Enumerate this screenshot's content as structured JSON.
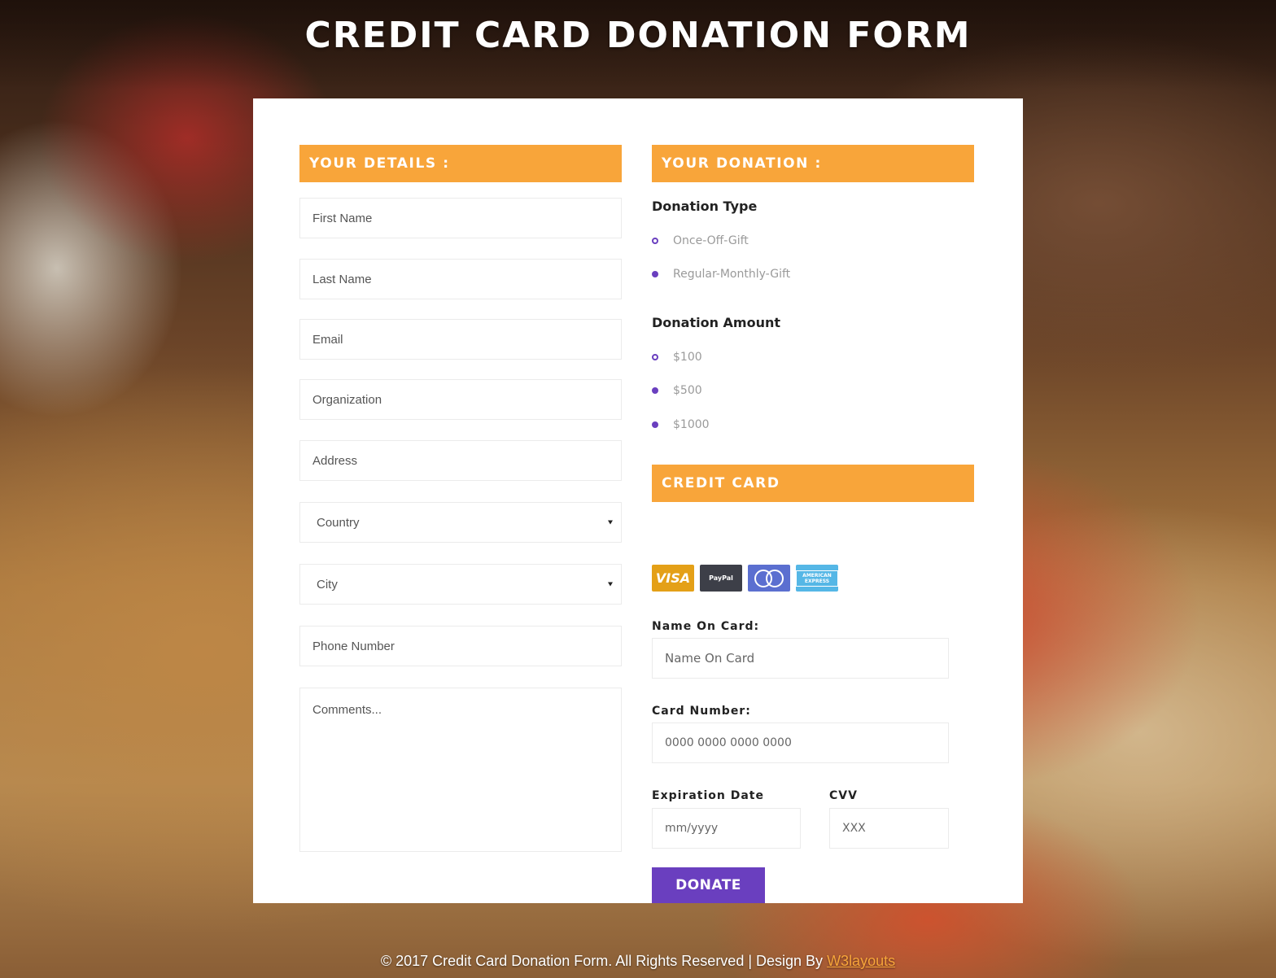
{
  "title": "CREDIT CARD DONATION FORM",
  "details": {
    "heading": "YOUR DETAILS :",
    "first_name": "First Name",
    "last_name": "Last Name",
    "email": "Email",
    "organization": "Organization",
    "address": "Address",
    "country": "Country",
    "city": "City",
    "phone": "Phone Number",
    "comments": "Comments..."
  },
  "donation": {
    "heading": "YOUR DONATION :",
    "type_label": "Donation Type",
    "types": [
      {
        "label": "Once-Off-Gift",
        "selected": false
      },
      {
        "label": "Regular-Monthly-Gift",
        "selected": true
      }
    ],
    "amount_label": "Donation Amount",
    "amounts": [
      {
        "label": "$100",
        "selected": false
      },
      {
        "label": "$500",
        "selected": true
      },
      {
        "label": "$1000",
        "selected": true
      }
    ]
  },
  "credit_card": {
    "heading": "CREDIT CARD",
    "logos": {
      "visa": "VISA",
      "paypal": "PayPal",
      "amex": "AMERICAN EXPRESS"
    },
    "name_label": "Name On Card:",
    "name_placeholder": "Name On Card",
    "number_label": "Card Number:",
    "number_placeholder": "0000 0000 0000 0000",
    "exp_label": "Expiration Date",
    "exp_placeholder": "mm/yyyy",
    "cvv_label": "CVV",
    "cvv_placeholder": "XXX",
    "donate_label": "DONATE"
  },
  "footer": {
    "text": "© 2017 Credit Card Donation Form. All Rights Reserved | Design By ",
    "link": "W3layouts"
  },
  "colors": {
    "accent": "#f8a53a",
    "primary": "#6a3fbf"
  }
}
